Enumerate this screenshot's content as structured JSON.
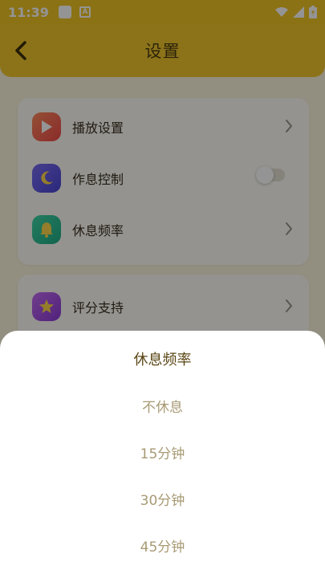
{
  "status_bar": {
    "time": "11:39",
    "notif_letter": "A"
  },
  "header": {
    "title": "设置"
  },
  "settings": {
    "group1": [
      {
        "label": "播放设置",
        "icon": "play-icon",
        "control": "chevron"
      },
      {
        "label": "作息控制",
        "icon": "moon-icon",
        "control": "toggle",
        "toggle_on": false
      },
      {
        "label": "休息频率",
        "icon": "bell-icon",
        "control": "chevron"
      }
    ],
    "group2": [
      {
        "label": "评分支持",
        "icon": "star-icon",
        "control": "chevron"
      }
    ]
  },
  "sheet": {
    "title": "休息频率",
    "options": [
      "不休息",
      "15分钟",
      "30分钟",
      "45分钟"
    ]
  },
  "colors": {
    "header_yellow": "#f2c62e",
    "sheet_option_text": "#a89a74",
    "sheet_title_text": "#5a4614"
  }
}
